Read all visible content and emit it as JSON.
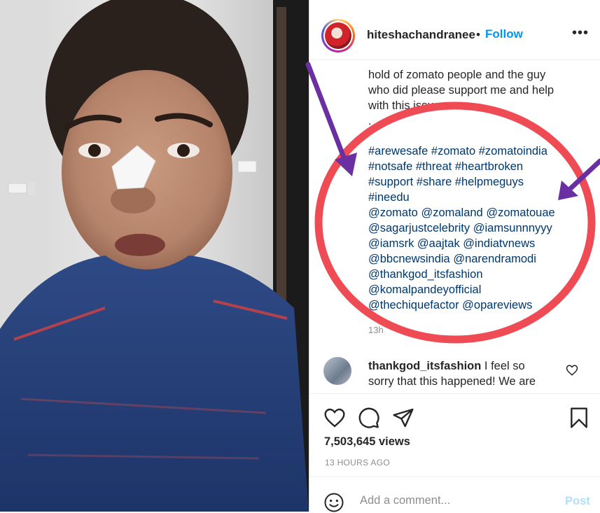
{
  "post": {
    "username": "hiteshachandranee",
    "separator": "•",
    "follow_label": "Follow",
    "more_label": "•••",
    "caption_lines": [
      "hold of zomato people and the guy",
      "who did please support me and help",
      "with this issue",
      "."
    ],
    "tag_lines": [
      "#arewesafe #zomato #zomatoindia",
      "#notsafe #threat #heartbroken",
      "#support #share #helpmeguys",
      "#ineedu",
      "@zomato @zomaland @zomatouae",
      "@sagarjustcelebrity @iamsunnnyyy",
      "@iamsrk @aajtak @indiatvnews",
      "@bbcnewsindia @narendramodi",
      "@thankgod_itsfashion",
      "@komalpandeyofficial",
      "@thechiquefactor @opareviews"
    ],
    "caption_time": "13h",
    "views": "7,503,645 views",
    "timestamp": "13 HOURS AGO"
  },
  "comment": {
    "username": "thankgod_itsfashion",
    "text_line1": " I feel so",
    "text_line2": "sorry that this happened! We are"
  },
  "add_comment": {
    "placeholder": "Add a comment...",
    "post_label": "Post"
  },
  "icons": {
    "like": "heart-icon",
    "comment": "comment-bubble-icon",
    "share": "paper-plane-icon",
    "save": "bookmark-icon",
    "emoji": "smiley-icon",
    "comment_like": "small-heart-icon"
  },
  "colors": {
    "follow": "#0095f6",
    "hashtag": "#00376b",
    "annotation_circle": "#ef4b55",
    "annotation_arrow": "#6a2fa0",
    "post_disabled": "#b2dffc"
  }
}
